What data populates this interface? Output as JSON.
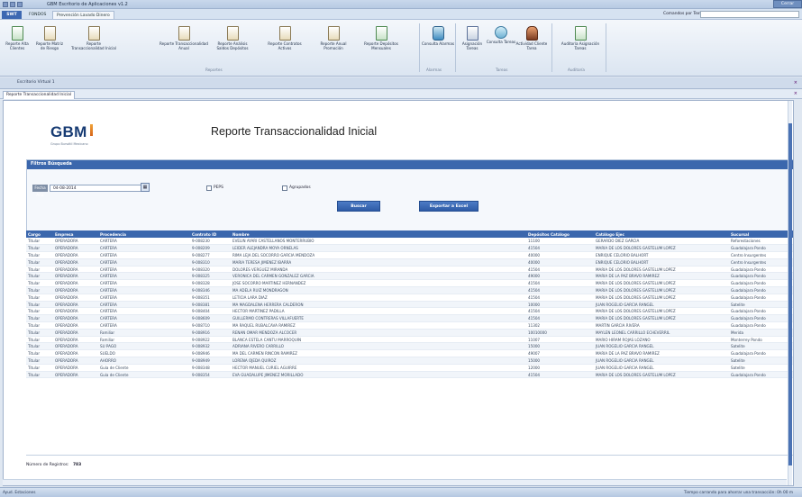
{
  "window": {
    "title": "GBM Escritorio de Aplicaciones v1.2",
    "buttons": "Cerrar"
  },
  "tabs": {
    "file": "SWT",
    "items": [
      "FONDOS",
      "Prevención Lavado Dinero"
    ],
    "active": 1
  },
  "search": {
    "label": "Comandos por Texto:",
    "value": ""
  },
  "ribbon": {
    "buttons": [
      {
        "label": "Reporte Alta Clientes",
        "icon": "document-green-icon"
      },
      {
        "label": "Reporte Matriz de Riesgo",
        "icon": "document-icon"
      },
      {
        "label": "Reporte Transaccionalidad Inicial",
        "icon": "document-icon"
      },
      {
        "label": "Reporte Transaccionalidad Anual",
        "icon": "document-icon"
      },
      {
        "label": "Reporte Análisis Saldos Depósitos",
        "icon": "document-icon"
      },
      {
        "label": "Reporte Contratos Activos",
        "icon": "document-icon"
      },
      {
        "label": "Reporte Anual Promoción",
        "icon": "document-icon"
      },
      {
        "label": "Reporte Depósitos Mensuales",
        "icon": "chart-icon"
      },
      {
        "label": "Consulta Alarmas",
        "icon": "alarm-icon"
      },
      {
        "label": "Asignación Tareas",
        "icon": "tools-icon"
      },
      {
        "label": "Consulta Tareas",
        "icon": "search-icon"
      },
      {
        "label": "Actividad Cliente Tarea",
        "icon": "person-icon"
      },
      {
        "label": "Auditoría Asignación Tareas",
        "icon": "audit-icon"
      }
    ],
    "groups": [
      "Reportes",
      "Alarmas",
      "Tareas",
      "Auditoría"
    ]
  },
  "doc_tab": "Escritorio Virtual 1",
  "report_tab": "Reporte Transaccionalidad Inicial",
  "logo": {
    "text": "GBM",
    "subtitle": "Grupo Bursátil Mexicano"
  },
  "report": {
    "title": "Reporte Transaccionalidad Inicial"
  },
  "filters": {
    "header": "Filtros Búsqueda",
    "date_label": "Fecha Alta",
    "date_value": "04-08-2014",
    "check1": "PEPS",
    "check2": "Agrupados",
    "search_btn": "Buscar",
    "export_btn": "Exportar a Excel"
  },
  "table": {
    "headers": [
      "Cargo",
      "Empresa",
      "Procedencia",
      "Contrato ID",
      "Nombre",
      "Depósitos Catálogo",
      "Catálogo Ejec",
      "Sucursal"
    ],
    "rows": [
      [
        "Titular",
        "OPERADORA",
        "CARTERA",
        "9-008230",
        "EVELIN AYARI CASTELLANOS MONTERRUBIO",
        "11100",
        "GERARDO DIEZ GARCIA",
        "Reforestaciones"
      ],
      [
        "Titular",
        "OPERADORA",
        "CARTERA",
        "9-008209",
        "LEIDER ALEJANDRA MOYA ORNELAS",
        "41504",
        "MARIA DE LOS DOLORES GASTELUM LOPEZ",
        "Guadalajara Pondo"
      ],
      [
        "Titular",
        "OPERADORA",
        "CARTERA",
        "9-008277",
        "RIMA LEJA DEL SOCORRO GARCIA MENDOZA",
        "40000",
        "ENRIQUE CELORIO BALHORT",
        "Centro Insurgentes"
      ],
      [
        "Titular",
        "OPERADORA",
        "CARTERA",
        "9-008310",
        "MARIA TERESA JIMENEZ IBARRA",
        "40000",
        "ENRIQUE CELORIO BALHORT",
        "Centro Insurgentes"
      ],
      [
        "Titular",
        "OPERADORA",
        "CARTERA",
        "9-008320",
        "DOLORES VERGUEZ MIRANDA",
        "41504",
        "MARIA DE LOS DOLORES GASTELUM LOPEZ",
        "Guadalajara Pondo"
      ],
      [
        "Titular",
        "OPERADORA",
        "CARTERA",
        "9-008325",
        "VERONICA DEL CARMEN GONZALEZ GARCIA",
        "49000",
        "MARIA DE LA PAZ BRAVO RAMIREZ",
        "Guadalajara Pondo"
      ],
      [
        "Titular",
        "OPERADORA",
        "CARTERA",
        "9-008328",
        "JOSE SOCORRO MARTINEZ HERNANDEZ",
        "41504",
        "MARIA DE LOS DOLORES GASTELUM LOPEZ",
        "Guadalajara Pondo"
      ],
      [
        "Titular",
        "OPERADORA",
        "CARTERA",
        "9-008346",
        "MA ADELA RUIZ MONDRAGON",
        "41504",
        "MARIA DE LOS DOLORES GASTELUM LOPEZ",
        "Guadalajara Pondo"
      ],
      [
        "Titular",
        "OPERADORA",
        "CARTERA",
        "9-008351",
        "LETICIA LARA DIAZ",
        "41504",
        "MARIA DE LOS DOLORES GASTELUM LOPEZ",
        "Guadalajara Pondo"
      ],
      [
        "Titular",
        "OPERADORA",
        "CARTERA",
        "9-008381",
        "MA MAGDALENA HERRERA CALDERON",
        "10000",
        "JUAN ROGELIO GARCIA RANGEL",
        "Satelite"
      ],
      [
        "Titular",
        "OPERADORA",
        "CARTERA",
        "9-008404",
        "HECTOR MARTINEZ PADILLA",
        "41504",
        "MARIA DE LOS DOLORES GASTELUM LOPEZ",
        "Guadalajara Pondo"
      ],
      [
        "Titular",
        "OPERADORA",
        "CARTERA",
        "9-008609",
        "GUILLERMO CONTRERAS VILLAFUERTE",
        "41504",
        "MARIA DE LOS DOLORES GASTELUM LOPEZ",
        "Guadalajara Pondo"
      ],
      [
        "Titular",
        "OPERADORA",
        "CARTERA",
        "9-008710",
        "MA RAQUEL RUBALCAVA RAMIREZ",
        "11302",
        "MARTIN GARCIA RIVERA",
        "Guadalajara Pondo"
      ],
      [
        "Titular",
        "OPERADORA",
        "Familiar",
        "9-008916",
        "RENAN OMAR MENDOZA ALCOCER",
        "10010000",
        "MAYLEN LEONEL CARRILLO ECHEVERRIL",
        "Merida"
      ],
      [
        "Titular",
        "OPERADORA",
        "Familiar",
        "9-008922",
        "BLANCA ESTELA CANTU MARROQUIN",
        "11007",
        "MARIO HIRAM ROJAS LOZANO",
        "Monterrey Pondo"
      ],
      [
        "Titular",
        "OPERADORA",
        "SU PAGO",
        "9-008932",
        "ADRIANA RIVERO CARRILLO",
        "15000",
        "JUAN ROGELIO GARCIA RANGEL",
        "Satelite"
      ],
      [
        "Titular",
        "OPERADORA",
        "SUELDO",
        "9-008946",
        "MA DEL CARMEN RINCON RAMIREZ",
        "49007",
        "MARIA DE LA PAZ BRAVO RAMIREZ",
        "Guadalajara Pondo"
      ],
      [
        "Titular",
        "OPERADORA",
        "AHORRO",
        "9-008949",
        "LORENA OJEDA QUIROZ",
        "15000",
        "JUAN ROGELIO GARCIA RANGEL",
        "Satelite"
      ],
      [
        "Titular",
        "OPERADORA",
        "Guía de Cliente",
        "9-008348",
        "HECTOR MANUEL CURIEL AGUIRRE",
        "12000",
        "JUAN ROGELIO GARCIA RANGEL",
        "Satelite"
      ],
      [
        "Titular",
        "OPERADORA",
        "Guía de Cliente",
        "9-008354",
        "EVA GUADALUPE JIMENEZ MORILLADO",
        "41504",
        "MARIA DE LOS DOLORES GASTELUM LOPEZ",
        "Guadalajara Pondo"
      ]
    ]
  },
  "footer": {
    "label": "Número de Registros:",
    "value": "783"
  },
  "status": {
    "left": "Ayud. Estaciones",
    "right": "Tiempo carrando para ahorrar una transacción: 0h 00 m"
  }
}
